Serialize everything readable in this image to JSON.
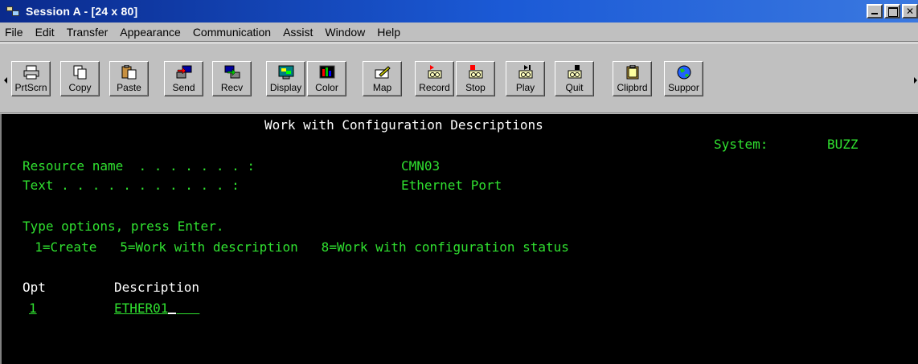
{
  "window": {
    "title": "Session A - [24 x 80]"
  },
  "menu": {
    "items": [
      "File",
      "Edit",
      "Transfer",
      "Appearance",
      "Communication",
      "Assist",
      "Window",
      "Help"
    ]
  },
  "toolbar": {
    "buttons": [
      {
        "label": "PrtScrn",
        "icon": "printer-icon"
      },
      {
        "label": "Copy",
        "icon": "copy-icon"
      },
      {
        "label": "Paste",
        "icon": "paste-icon"
      },
      {
        "label": "Send",
        "icon": "send-icon"
      },
      {
        "label": "Recv",
        "icon": "receive-icon"
      },
      {
        "label": "Display",
        "icon": "display-icon"
      },
      {
        "label": "Color",
        "icon": "color-icon"
      },
      {
        "label": "Map",
        "icon": "map-icon"
      },
      {
        "label": "Record",
        "icon": "record-icon"
      },
      {
        "label": "Stop",
        "icon": "stop-icon"
      },
      {
        "label": "Play",
        "icon": "play-icon"
      },
      {
        "label": "Quit",
        "icon": "quit-icon"
      },
      {
        "label": "Clipbrd",
        "icon": "clipboard-icon"
      },
      {
        "label": "Suppor",
        "icon": "support-globe-icon"
      }
    ]
  },
  "screen": {
    "title": "Work with Configuration Descriptions",
    "system_label": "System:",
    "system_value": "BUZZ",
    "resource_label": "Resource name  . . . . . . . :",
    "resource_value": "CMN03",
    "text_label": "Text . . . . . . . . . . . :",
    "text_value": "Ethernet Port",
    "instructions": "Type options, press Enter.",
    "options_line": "  1=Create   5=Work with description   8=Work with configuration status",
    "col_opt": "Opt",
    "col_description": "Description",
    "rows": [
      {
        "opt": "1",
        "description": "ETHER01"
      }
    ]
  },
  "colors": {
    "terminal_bg": "#000000",
    "terminal_green": "#30e030",
    "terminal_white": "#ffffff",
    "titlebar": "#0a2a8c"
  }
}
